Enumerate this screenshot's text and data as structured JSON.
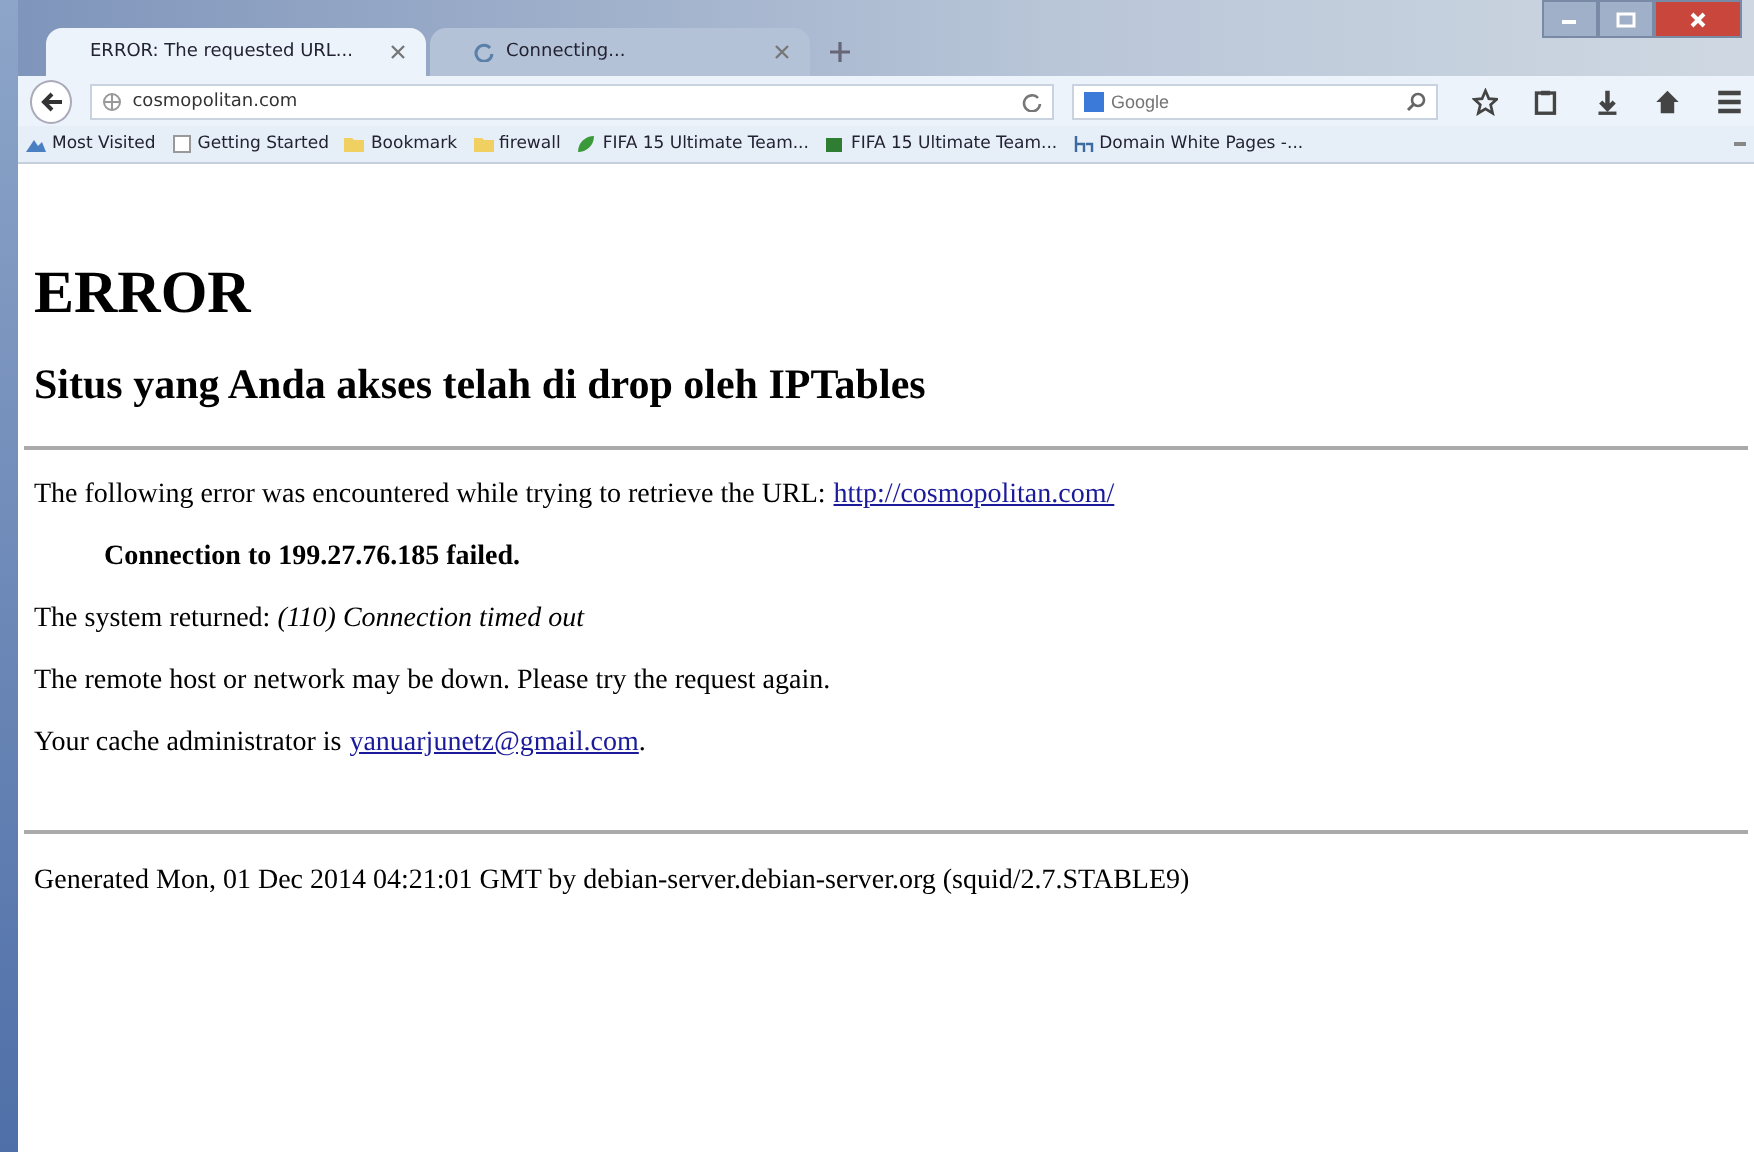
{
  "tabs": [
    {
      "label": "ERROR: The requested URL...",
      "selected": true,
      "loading": false
    },
    {
      "label": "Connecting...",
      "selected": false,
      "loading": true
    }
  ],
  "toolbar": {
    "url": "cosmopolitan.com",
    "search_placeholder": "Google"
  },
  "bookmarks": [
    {
      "label": "Most Visited",
      "kind": "visited"
    },
    {
      "label": "Getting Started",
      "kind": "page"
    },
    {
      "label": "Bookmark",
      "kind": "folder"
    },
    {
      "label": "firewall",
      "kind": "folder"
    },
    {
      "label": "FIFA 15 Ultimate Team...",
      "kind": "leaf"
    },
    {
      "label": "FIFA 15 Ultimate Team...",
      "kind": "app"
    },
    {
      "label": "Domain White Pages -...",
      "kind": "hn"
    }
  ],
  "page": {
    "heading": "ERROR",
    "subheading": "Situs yang Anda akses telah di drop oleh IPTables",
    "blocks": [
      {
        "kind": "text",
        "text": "The following error was encountered while trying to retrieve the URL:",
        "link": "http://cosmopolitan.com/"
      },
      {
        "kind": "strong",
        "text": "Connection to 199.27.76.185 failed."
      },
      {
        "kind": "text",
        "text": "The system returned: *(110) Connection timed out*"
      },
      {
        "kind": "text",
        "text": "The remote host or network may be down. Please try the request again."
      },
      {
        "kind": "text",
        "text": "Your cache administrator is",
        "link": "yanuarjunetz@gmail.com",
        "after": "."
      }
    ],
    "footer": "Generated Mon, 01 Dec 2014 04:21:01 GMT by debian-server.debian-server.org (squid/2.7.STABLE9)"
  }
}
